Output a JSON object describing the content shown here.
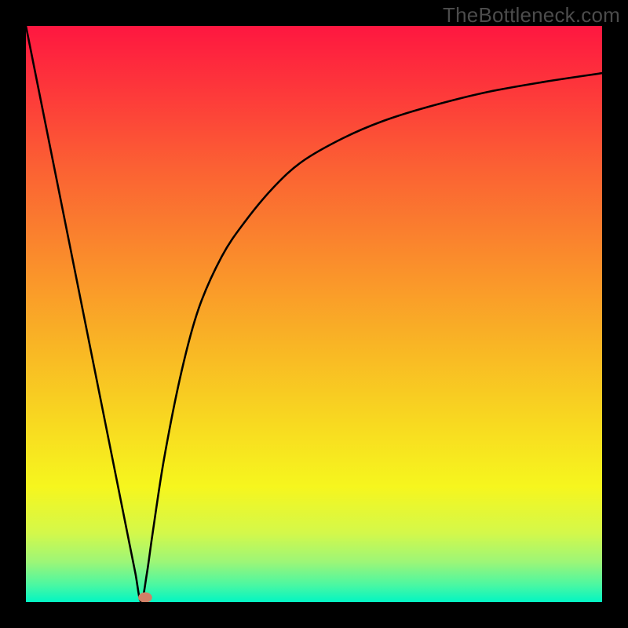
{
  "watermark": "TheBottleneck.com",
  "chart_data": {
    "type": "line",
    "title": "",
    "xlabel": "",
    "ylabel": "",
    "xlim": [
      0,
      100
    ],
    "ylim": [
      0,
      100
    ],
    "grid": false,
    "legend": false,
    "background_gradient": {
      "stops": [
        {
          "offset": 0.0,
          "color": "#fe1740"
        },
        {
          "offset": 0.12,
          "color": "#fd3a3a"
        },
        {
          "offset": 0.25,
          "color": "#fb6233"
        },
        {
          "offset": 0.4,
          "color": "#fa8b2c"
        },
        {
          "offset": 0.55,
          "color": "#f9b425"
        },
        {
          "offset": 0.7,
          "color": "#f8dc20"
        },
        {
          "offset": 0.8,
          "color": "#f6f61e"
        },
        {
          "offset": 0.88,
          "color": "#d4f84a"
        },
        {
          "offset": 0.93,
          "color": "#9df677"
        },
        {
          "offset": 0.97,
          "color": "#4bf7a2"
        },
        {
          "offset": 1.0,
          "color": "#02f6c3"
        }
      ]
    },
    "series": [
      {
        "name": "bottleneck-curve",
        "x": [
          0.0,
          5.0,
          10.0,
          15.0,
          18.0,
          19.0,
          20.0,
          21.0,
          22.0,
          24.0,
          27.0,
          30.0,
          34.0,
          38.0,
          43.0,
          48.0,
          55.0,
          62.0,
          70.0,
          80.0,
          90.0,
          100.0
        ],
        "y": [
          100.0,
          75.0,
          50.0,
          25.0,
          10.0,
          5.0,
          0.0,
          5.0,
          12.0,
          25.0,
          40.0,
          51.0,
          60.0,
          66.0,
          72.0,
          76.5,
          80.5,
          83.5,
          86.0,
          88.5,
          90.3,
          91.8
        ]
      }
    ],
    "marker": {
      "name": "optimal-point",
      "x": 20.7,
      "y": 0.8,
      "color": "#d08067",
      "rx": 1.2,
      "ry": 0.9
    }
  }
}
